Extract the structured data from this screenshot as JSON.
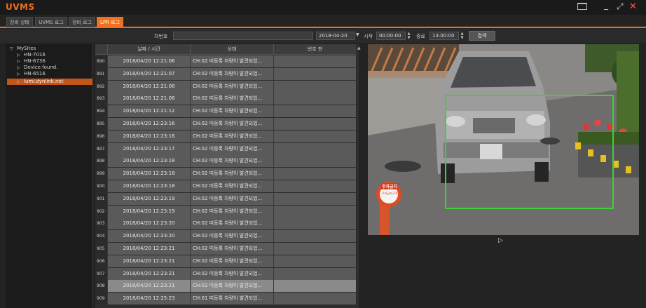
{
  "app": {
    "title": "UVMS"
  },
  "tabs": [
    {
      "label": "장비 상태",
      "active": false
    },
    {
      "label": "UVMS 로그",
      "active": false
    },
    {
      "label": "장비 로그",
      "active": false
    },
    {
      "label": "LPR 로그",
      "active": true
    }
  ],
  "search": {
    "plate_label": "차번호",
    "plate_value": "",
    "date_value": "2018-04-20",
    "start_label": "시작",
    "start_value": "00:00:00",
    "end_label": "종료",
    "end_value": "13:00:00",
    "search_button": "검색"
  },
  "tree": {
    "root": "MySites",
    "items": [
      {
        "label": "HN-7016",
        "selected": false
      },
      {
        "label": "HN-6736",
        "selected": false
      },
      {
        "label": "Device found.",
        "selected": false
      },
      {
        "label": "HN-6516",
        "selected": false
      },
      {
        "label": "lumi.dynlink.net",
        "selected": true
      }
    ]
  },
  "table": {
    "headers": [
      "날짜 / 시간",
      "상태",
      "번호 판"
    ],
    "rows": [
      {
        "num": "890",
        "datetime": "2018/04/20 12:21:06",
        "status": "CH:02 미등록 차량이 발견되었...",
        "plate": ""
      },
      {
        "num": "891",
        "datetime": "2018/04/20 12:21:07",
        "status": "CH:02 미등록 차량이 발견되었...",
        "plate": ""
      },
      {
        "num": "892",
        "datetime": "2018/04/20 12:21:08",
        "status": "CH:02 미등록 차량이 발견되었...",
        "plate": ""
      },
      {
        "num": "893",
        "datetime": "2018/04/20 12:21:08",
        "status": "CH:02 미등록 차량이 발견되었...",
        "plate": ""
      },
      {
        "num": "894",
        "datetime": "2018/04/20 12:21:12",
        "status": "CH:02 미등록 차량이 발견되었...",
        "plate": ""
      },
      {
        "num": "895",
        "datetime": "2018/04/20 12:23:16",
        "status": "CH:02 미등록 차량이 발견되었...",
        "plate": ""
      },
      {
        "num": "896",
        "datetime": "2018/04/20 12:23:16",
        "status": "CH:02 미등록 차량이 발견되었...",
        "plate": ""
      },
      {
        "num": "897",
        "datetime": "2018/04/20 12:23:17",
        "status": "CH:02 미등록 차량이 발견되었...",
        "plate": ""
      },
      {
        "num": "898",
        "datetime": "2018/04/20 12:23:18",
        "status": "CH:02 미등록 차량이 발견되었...",
        "plate": ""
      },
      {
        "num": "899",
        "datetime": "2018/04/20 12:23:18",
        "status": "CH:02 미등록 차량이 발견되었...",
        "plate": ""
      },
      {
        "num": "900",
        "datetime": "2018/04/20 12:23:18",
        "status": "CH:02 미등록 차량이 발견되었...",
        "plate": ""
      },
      {
        "num": "901",
        "datetime": "2018/04/20 12:23:19",
        "status": "CH:02 미등록 차량이 발견되었...",
        "plate": ""
      },
      {
        "num": "902",
        "datetime": "2018/04/20 12:23:19",
        "status": "CH:02 미등록 차량이 발견되었...",
        "plate": ""
      },
      {
        "num": "903",
        "datetime": "2018/04/20 12:23:20",
        "status": "CH:02 미등록 차량이 발견되었...",
        "plate": ""
      },
      {
        "num": "904",
        "datetime": "2018/04/20 12:23:20",
        "status": "CH:02 미등록 차량이 발견되었...",
        "plate": ""
      },
      {
        "num": "905",
        "datetime": "2018/04/20 12:23:21",
        "status": "CH:02 미등록 차량이 발견되었...",
        "plate": ""
      },
      {
        "num": "906",
        "datetime": "2018/04/20 12:23:21",
        "status": "CH:02 미등록 차량이 발견되었...",
        "plate": ""
      },
      {
        "num": "907",
        "datetime": "2018/04/20 12:23:21",
        "status": "CH:02 미등록 차량이 발견되었...",
        "plate": ""
      },
      {
        "num": "908",
        "datetime": "2018/04/20 12:23:21",
        "status": "CH:02 미등록 차량이 발견되었...",
        "plate": "",
        "selected": true
      },
      {
        "num": "909",
        "datetime": "2018/04/20 12:25:23",
        "status": "CH:01 미등록 차량이 발견되었...",
        "plate": ""
      }
    ]
  },
  "video": {
    "sign_text_1": "주차금지",
    "sign_text_2": "주차금지구역"
  },
  "colors": {
    "accent": "#f0701e",
    "detection_box": "#3bd13b"
  }
}
